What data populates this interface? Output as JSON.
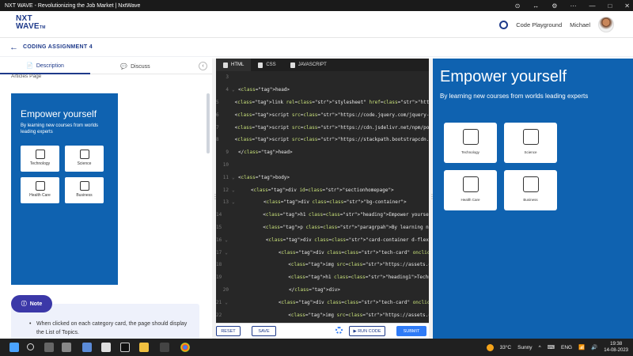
{
  "window": {
    "title": "NXT WAVE - Revolutionizing the Job Market | NxtWave",
    "controls": [
      "⊙",
      "↔",
      "⚙",
      "⋯",
      "—",
      "□",
      "✕"
    ]
  },
  "header": {
    "logo_line1": "NXT",
    "logo_line2": "WAVE",
    "logo_tm": "TM",
    "code_playground": "Code Playground",
    "user_name": "Michael"
  },
  "assignment": {
    "title": "CODING ASSIGNMENT 4"
  },
  "left": {
    "tabs": [
      {
        "label": "Description",
        "icon": "📄"
      },
      {
        "label": "Discuss",
        "icon": "💬"
      }
    ],
    "collapse_icon": "‹",
    "article_text": "Articles Page",
    "preview": {
      "heading": "Empower yourself",
      "para": "By learning new courses from worlds leading experts",
      "cards": [
        "Technology",
        "Science",
        "Health Care",
        "Business"
      ]
    },
    "note": {
      "label": "Note",
      "icon": "ⓘ",
      "text": "When clicked on each category card, the page should display the List of Topics."
    }
  },
  "editor": {
    "tabs": [
      {
        "label": "HTML"
      },
      {
        "label": "CSS"
      },
      {
        "label": "JAVASCRIPT"
      }
    ],
    "lines": [
      {
        "n": "3",
        "g": "",
        "indent": 0,
        "t": ""
      },
      {
        "n": "4",
        "g": "⌄",
        "indent": 0,
        "t": "<head>"
      },
      {
        "n": "5",
        "g": "",
        "indent": 1,
        "t": "<link rel=\"stylesheet\" href=\"https://stackpath.bootstra"
      },
      {
        "n": "6",
        "g": "",
        "indent": 1,
        "t": "<script src=\"https://code.jquery.com/jquery-3.5.1.slim."
      },
      {
        "n": "7",
        "g": "",
        "indent": 1,
        "t": "<script src=\"https://cdn.jsdelivr.net/npm/popper.js@1.1"
      },
      {
        "n": "8",
        "g": "",
        "indent": 1,
        "t": "<script src=\"https://stackpath.bootstrapcdn.com/bootstr"
      },
      {
        "n": "9",
        "g": "",
        "indent": 0,
        "t": "</head>"
      },
      {
        "n": "10",
        "g": "",
        "indent": 0,
        "t": ""
      },
      {
        "n": "11",
        "g": "⌄",
        "indent": 0,
        "t": "<body>"
      },
      {
        "n": "12",
        "g": "⌄",
        "indent": 1,
        "t": "<div id=\"sectionhomepage\">"
      },
      {
        "n": "13",
        "g": "⌄",
        "indent": 2,
        "t": "<div class=\"bg-container\">"
      },
      {
        "n": "14",
        "g": "",
        "indent": 3,
        "t": "<h1 class=\"heading\">Empower yourself</h1>"
      },
      {
        "n": "15",
        "g": "",
        "indent": 3,
        "t": "<p class=\"paragrpah\">By learning new courses fr"
      },
      {
        "n": "16",
        "g": "⌄",
        "indent": 3,
        "t": "<div class=\"card-container d-flex flex-row\">"
      },
      {
        "n": "17",
        "g": "⌄",
        "indent": 4,
        "t": "<div class=\"tech-card\" onclick=\"display('se"
      },
      {
        "n": "18",
        "g": "",
        "indent": 5,
        "t": "<img src=\"https://assets.ccbp.in/fronte"
      },
      {
        "n": "19",
        "g": "",
        "indent": 5,
        "t": "<h1 class=\"heading1\">Technology</h1>"
      },
      {
        "n": "20",
        "g": "",
        "indent": 4,
        "t": "</div>"
      },
      {
        "n": "21",
        "g": "⌄",
        "indent": 4,
        "t": "<div class=\"tech-card\" onclick=\"display('se"
      },
      {
        "n": "22",
        "g": "",
        "indent": 5,
        "t": "<img src=\"https://assets.ccbp.in/fronte"
      },
      {
        "n": "23",
        "g": "",
        "indent": 5,
        "t": "<h1 class=\"heading1\">Science</h1>"
      },
      {
        "n": "24",
        "g": "",
        "indent": 4,
        "t": "</div>"
      },
      {
        "n": "25",
        "g": "",
        "indent": 3,
        "t": "</div>"
      },
      {
        "n": "26",
        "g": "⌄",
        "indent": 3,
        "t": "<div class=\"card-container d-flex flex-row\">"
      }
    ],
    "buttons": {
      "reset": "RESET",
      "save": "SAVE",
      "run": "▶ RUN CODE",
      "submit": "SUBMIT"
    }
  },
  "preview": {
    "heading": "Empower yourself",
    "para": "By learning new courses from worlds leading experts",
    "cards": [
      "Technology",
      "Science",
      "Health Care",
      "Business"
    ]
  },
  "taskbar": {
    "weather_temp": "33°C",
    "weather_text": "Sunny",
    "lang": "ENG",
    "time": "19:38",
    "date": "14-08-2023",
    "tray_glyphs": [
      "^",
      "⌨",
      "📶",
      "🔊"
    ]
  },
  "colors": {
    "primary": "#1e3a8a",
    "preview_bg": "#0f62b0",
    "editor_bg": "#272727",
    "submit": "#2f7bf6",
    "note_pill": "#3b38a8"
  }
}
